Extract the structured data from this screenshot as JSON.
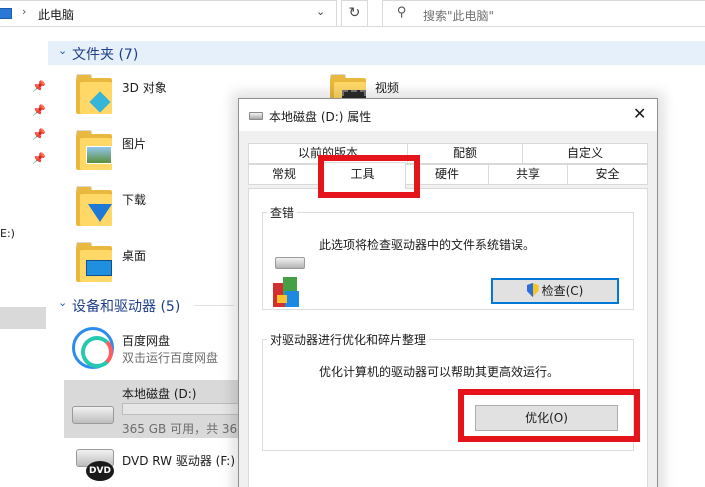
{
  "explorer": {
    "breadcrumb": "此电脑",
    "breadcrumb_sep": "›",
    "dropdown_glyph": "⌄",
    "refresh_glyph": "↻",
    "search_placeholder": "搜索\"此电脑\"",
    "nav_drive_fragment": "E:)",
    "folders_group": {
      "title": "文件夹 (7)",
      "chevron": "⌄"
    },
    "folders": [
      {
        "label": "3D 对象"
      },
      {
        "label": "视频"
      },
      {
        "label": "图片"
      },
      {
        "label": "下载"
      },
      {
        "label": "桌面"
      }
    ],
    "devices_group": {
      "title": "设备和驱动器 (5)",
      "chevron": "⌄"
    },
    "devices": [
      {
        "label": "百度网盘",
        "sub": "双击运行百度网盘"
      },
      {
        "label": "本地磁盘 (D:)",
        "sub": "365 GB 可用，共 366",
        "used_fraction": 0.0
      },
      {
        "label": "DVD RW 驱动器 (F:)",
        "badge": "DVD"
      }
    ]
  },
  "dialog": {
    "title": "本地磁盘 (D:) 属性",
    "close_glyph": "✕",
    "tabs_row1": [
      "以前的版本",
      "配额",
      "自定义"
    ],
    "tabs_row2": [
      "常规",
      "工具",
      "硬件",
      "共享",
      "安全"
    ],
    "active_tab": "工具",
    "check_group": {
      "title": "查错",
      "desc": "此选项将检查驱动器中的文件系统错误。",
      "button": "检查(C)"
    },
    "optimize_group": {
      "title": "对驱动器进行优化和碎片整理",
      "desc": "优化计算机的驱动器可以帮助其更高效运行。",
      "button": "优化(O)"
    }
  },
  "colors": {
    "highlight": "#e5131a",
    "accent": "#0078d7",
    "group_title": "#1e3f8a",
    "folder": "#ffd867"
  },
  "icons": {
    "pin": "pin-icon",
    "search": "search-icon",
    "shield": "uac-shield-icon"
  }
}
